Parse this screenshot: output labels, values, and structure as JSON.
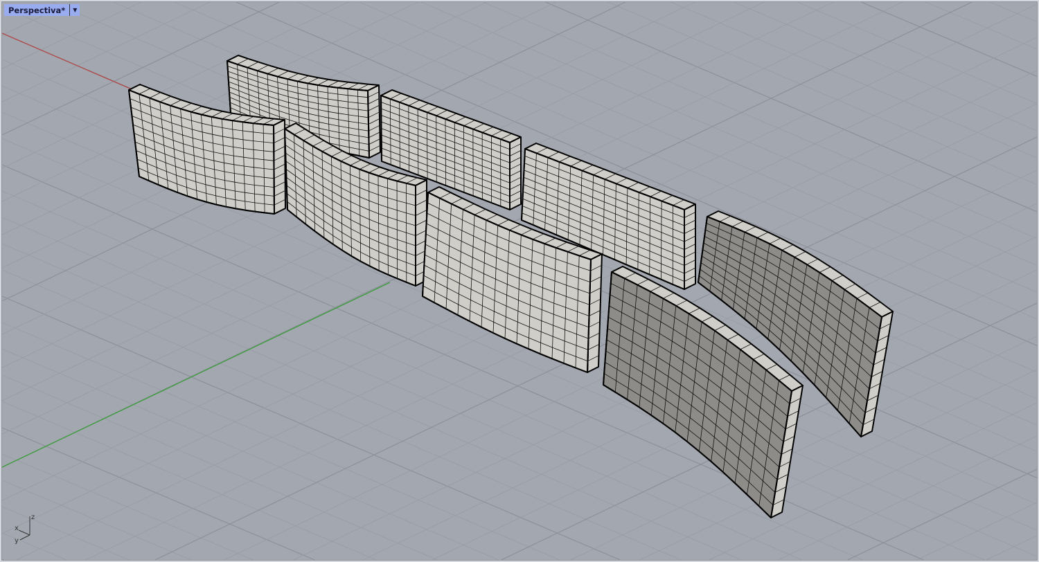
{
  "viewport": {
    "title": "Perspectiva*",
    "menu_icon": "dropdown-arrow"
  },
  "axis_widget": {
    "x": "x",
    "y": "y",
    "z": "z"
  },
  "colors": {
    "background": "#a3a8b0",
    "grid": "#979ca4",
    "grid_major": "#8c9098",
    "x_axis": "#b04848",
    "y_axis": "#3c9c3c",
    "panel_light": "#d0cec9",
    "panel_dark": "#8d8c89",
    "edge": "#000000",
    "tab": "#9aacf0"
  }
}
